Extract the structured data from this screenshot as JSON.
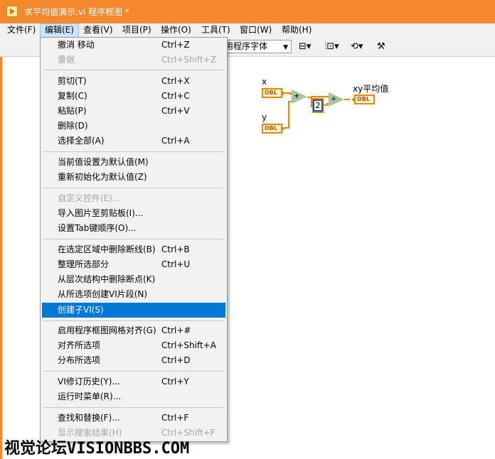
{
  "window": {
    "title": "求平均值演示.vi 程序框图 *"
  },
  "menubar": [
    {
      "label": "文件(F)"
    },
    {
      "label": "编辑(E)"
    },
    {
      "label": "查看(V)"
    },
    {
      "label": "项目(P)"
    },
    {
      "label": "操作(O)"
    },
    {
      "label": "工具(T)"
    },
    {
      "label": "窗口(W)"
    },
    {
      "label": "帮助(H)"
    }
  ],
  "toolbar": {
    "font_select": "用程序字体",
    "icons": [
      "align-objects-icon",
      "distribute-objects-icon",
      "reorder-icon",
      "cleanup-diagram-icon"
    ]
  },
  "edit_menu": {
    "items": [
      {
        "label": "撤消 移动",
        "shortcut": "Ctrl+Z",
        "enabled": true
      },
      {
        "label": "重做",
        "shortcut": "Ctrl+Shift+Z",
        "enabled": false
      },
      {
        "label": "剪切(T)",
        "shortcut": "Ctrl+X",
        "enabled": true
      },
      {
        "label": "复制(C)",
        "shortcut": "Ctrl+C",
        "enabled": true
      },
      {
        "label": "粘贴(P)",
        "shortcut": "Ctrl+V",
        "enabled": true
      },
      {
        "label": "删除(D)",
        "shortcut": "",
        "enabled": true
      },
      {
        "label": "选择全部(A)",
        "shortcut": "Ctrl+A",
        "enabled": true
      },
      {
        "label": "当前值设置为默认值(M)",
        "shortcut": "",
        "enabled": true
      },
      {
        "label": "重新初始化为默认值(Z)",
        "shortcut": "",
        "enabled": true
      },
      {
        "label": "自定义控件(E)...",
        "shortcut": "",
        "enabled": false
      },
      {
        "label": "导入图片至剪贴板(I)...",
        "shortcut": "",
        "enabled": true
      },
      {
        "label": "设置Tab键顺序(O)...",
        "shortcut": "",
        "enabled": true
      },
      {
        "label": "在选定区域中删除断线(B)",
        "shortcut": "Ctrl+B",
        "enabled": true
      },
      {
        "label": "整理所选部分",
        "shortcut": "Ctrl+U",
        "enabled": true
      },
      {
        "label": "从层次结构中删除断点(K)",
        "shortcut": "",
        "enabled": true
      },
      {
        "label": "从所选项创建VI片段(N)",
        "shortcut": "",
        "enabled": true
      },
      {
        "label": "创建子VI(S)",
        "shortcut": "",
        "enabled": true,
        "selected": true
      },
      {
        "label": "启用程序框图网格对齐(G)",
        "shortcut": "Ctrl+#",
        "enabled": true
      },
      {
        "label": "对齐所选项",
        "shortcut": "Ctrl+Shift+A",
        "enabled": true
      },
      {
        "label": "分布所选项",
        "shortcut": "Ctrl+D",
        "enabled": true
      },
      {
        "label": "VI修订历史(Y)...",
        "shortcut": "Ctrl+Y",
        "enabled": true
      },
      {
        "label": "运行时菜单(R)...",
        "shortcut": "",
        "enabled": true
      },
      {
        "label": "查找和替换(F)...",
        "shortcut": "Ctrl+F",
        "enabled": true
      },
      {
        "label": "显示搜索结果(H)",
        "shortcut": "Ctrl+Shift+F",
        "enabled": false
      }
    ]
  },
  "diagram": {
    "x_label": "x",
    "y_label": "y",
    "output_label": "xy平均值",
    "type_tag": "DBL",
    "add_symbol": "+",
    "divide_symbol": "÷",
    "constant": "2"
  },
  "colors": {
    "titlebar": "#f5882d",
    "menu_selected": "#0078d7",
    "wire_orange": "#f08000"
  },
  "watermark": "视觉论坛VISIONBBS.COM"
}
